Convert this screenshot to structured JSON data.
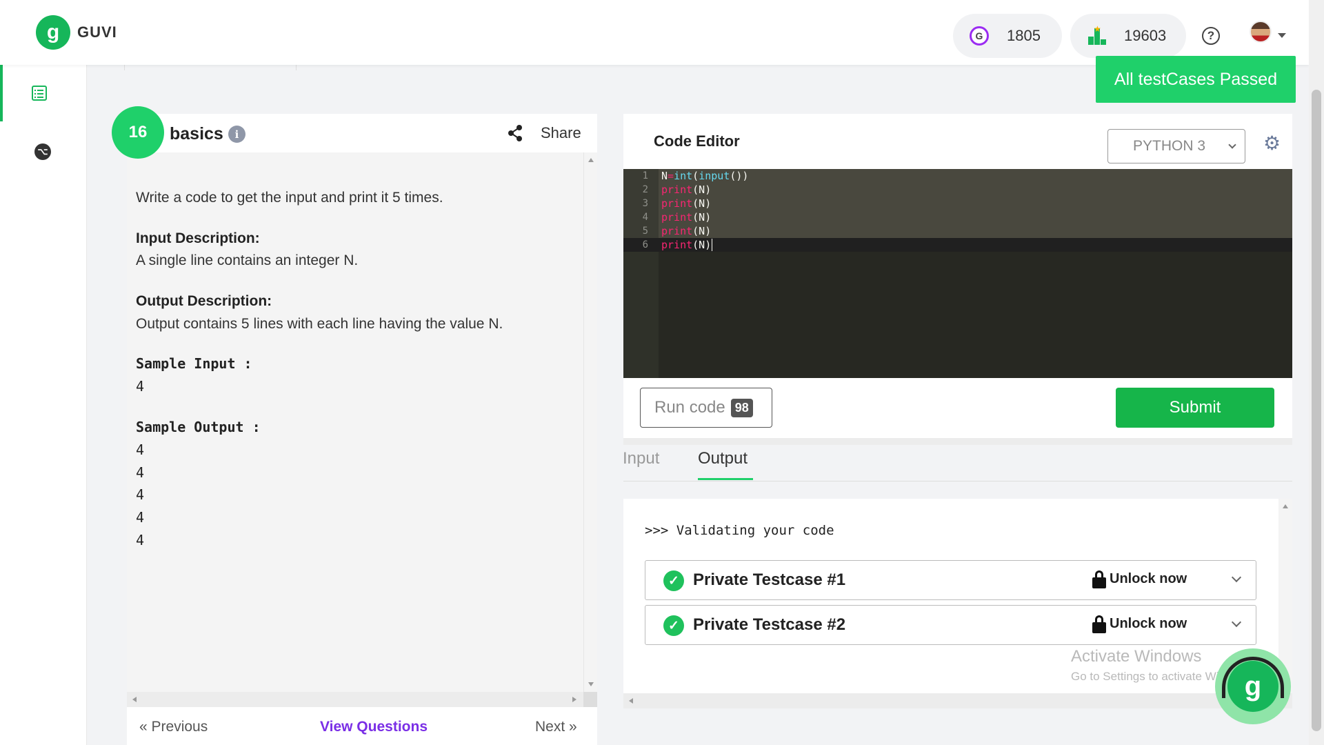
{
  "header": {
    "logo_text": "GUVI",
    "logo_glyph": "g",
    "coins": "1805",
    "coin_glyph": "G",
    "rank": "19603",
    "help_glyph": "?"
  },
  "toast": "All testCases Passed",
  "question": {
    "number": "16",
    "title": "basics",
    "share_label": "Share",
    "statement": "Write a code to get the input and print it 5 times.",
    "input_heading": "Input Description:",
    "input_text": "A single line contains an integer N.",
    "output_heading": "Output Description:",
    "output_text": "Output contains 5 lines with each line having the value N.",
    "sample_input_heading": "Sample Input :",
    "sample_input": [
      "4"
    ],
    "sample_output_heading": "Sample Output :",
    "sample_output": [
      "4",
      "4",
      "4",
      "4",
      "4"
    ]
  },
  "nav": {
    "previous": "«  Previous",
    "view_questions": "View Questions",
    "next": "Next  »"
  },
  "editor": {
    "title": "Code Editor",
    "language": "PYTHON 3",
    "line_numbers": [
      "1",
      "2",
      "3",
      "4",
      "5",
      "6"
    ],
    "run_label": "Run code",
    "run_count": "98",
    "submit_label": "Submit"
  },
  "io_tabs": {
    "input": "Input",
    "output": "Output"
  },
  "output": {
    "validating": ">>> Validating your code",
    "testcases": [
      {
        "label": "Private Testcase #1",
        "action": "Unlock now"
      },
      {
        "label": "Private Testcase #2",
        "action": "Unlock now"
      }
    ]
  },
  "watermark": {
    "line1": "Activate Windows",
    "line2": "Go to Settings to activate Windows."
  },
  "colors": {
    "brand_green": "#16b65a",
    "accent_purple": "#7a2ee6",
    "editor_bg": "#272822"
  },
  "icons": [
    "list-icon",
    "github-icon",
    "share-icon",
    "info-icon",
    "gear-icon",
    "lock-icon",
    "check-icon",
    "chevron-down-icon",
    "help-icon"
  ]
}
